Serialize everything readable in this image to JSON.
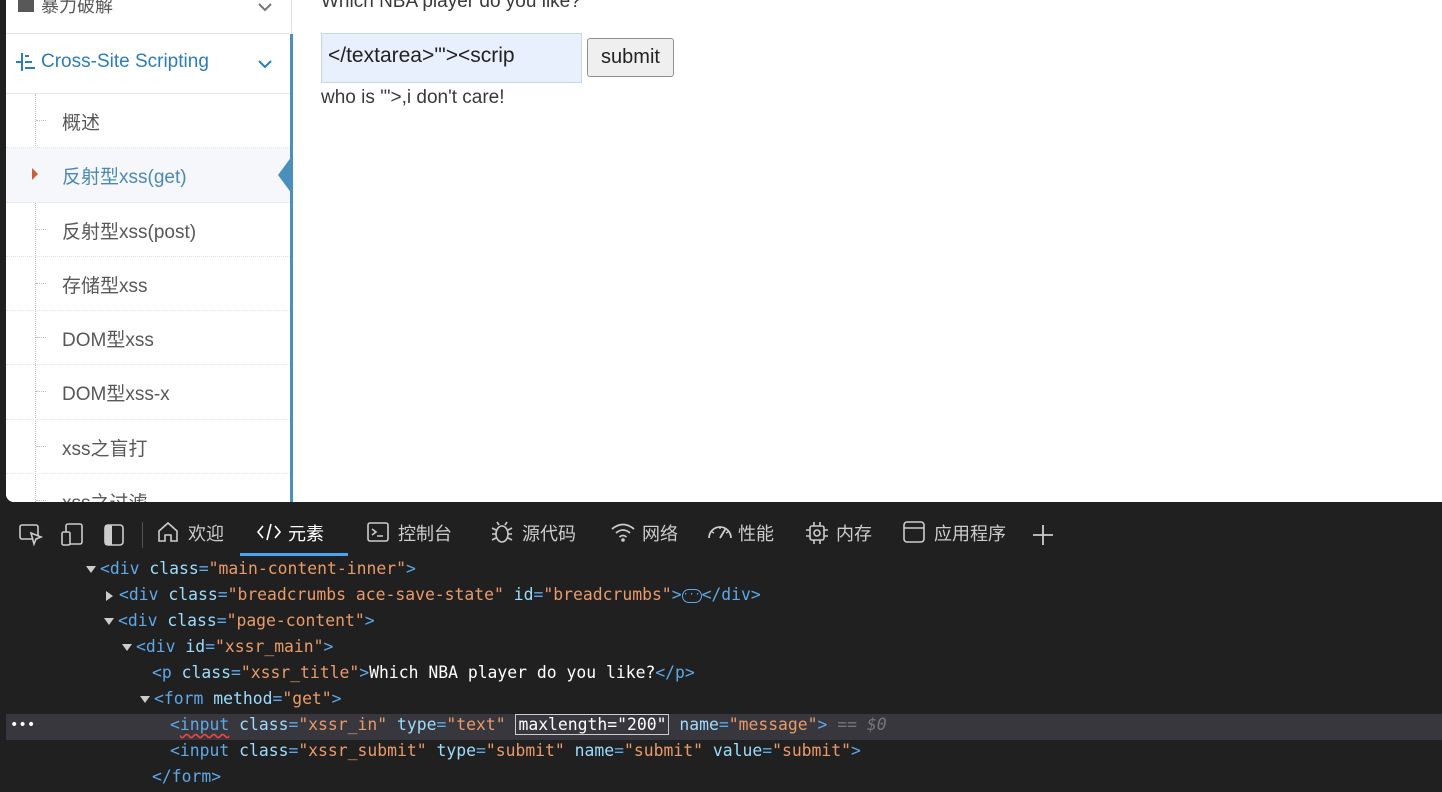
{
  "sidebar": {
    "top_item": {
      "label": "暴力破解"
    },
    "section": {
      "label": "Cross-Site Scripting"
    },
    "items": [
      {
        "label": "概述"
      },
      {
        "label": "反射型xss(get)"
      },
      {
        "label": "反射型xss(post)"
      },
      {
        "label": "存储型xss"
      },
      {
        "label": "DOM型xss"
      },
      {
        "label": "DOM型xss-x"
      },
      {
        "label": "xss之盲打"
      },
      {
        "label": "xss之过滤"
      }
    ]
  },
  "main": {
    "title": "Which NBA player do you like?",
    "input_value": "</textarea>'\"><scrip",
    "submit_label": "submit",
    "result": "who is '\">,i don't care!"
  },
  "devtools": {
    "tabs": [
      {
        "label": "欢迎"
      },
      {
        "label": "元素"
      },
      {
        "label": "控制台"
      },
      {
        "label": "源代码"
      },
      {
        "label": "网络"
      },
      {
        "label": "性能"
      },
      {
        "label": "内存"
      },
      {
        "label": "应用程序"
      }
    ],
    "active_tab": "元素",
    "dom": {
      "l1": {
        "tag": "div",
        "attr": "class",
        "val": "\"main-content-inner\""
      },
      "l2": {
        "tag": "div",
        "attr1": "class",
        "val1": "\"breadcrumbs ace-save-state\"",
        "attr2": "id",
        "val2": "\"breadcrumbs\"",
        "ellipsis": "···",
        "close": "</div>"
      },
      "l3": {
        "tag": "div",
        "attr": "class",
        "val": "\"page-content\""
      },
      "l4": {
        "tag": "div",
        "attr": "id",
        "val": "\"xssr_main\""
      },
      "l5": {
        "tag": "p",
        "attr": "class",
        "val": "\"xssr_title\"",
        "text": "Which NBA player do you like?",
        "close": "</p>"
      },
      "l6": {
        "tag": "form",
        "attr": "method",
        "val": "\"get\""
      },
      "l7": {
        "tag": "input",
        "attr1": "class",
        "val1": "\"xssr_in\"",
        "attr2": "type",
        "val2": "\"text\"",
        "attr3": "maxlength",
        "val3": "\"200\"",
        "attr4": "name",
        "val4": "\"message\"",
        "marker": "== $0",
        "dots": "•••"
      },
      "l8": {
        "tag": "input",
        "attr1": "class",
        "val1": "\"xssr_submit\"",
        "attr2": "type",
        "val2": "\"submit\"",
        "attr3": "name",
        "val3": "\"submit\"",
        "attr4": "value",
        "val4": "\"submit\""
      },
      "l9": {
        "close": "</form>"
      }
    }
  },
  "colors": {
    "sidebar_accent": "#4c8fbd",
    "section_text": "#2b7dbc",
    "active_item_text": "#4b88b7",
    "caret": "#c86139",
    "devtools_bg": "#202020",
    "devtools_tab_underline": "#4aa3f0",
    "tag": "#5fa8e8",
    "attr_name": "#9cdcfe",
    "attr_value": "#e99a6a"
  }
}
